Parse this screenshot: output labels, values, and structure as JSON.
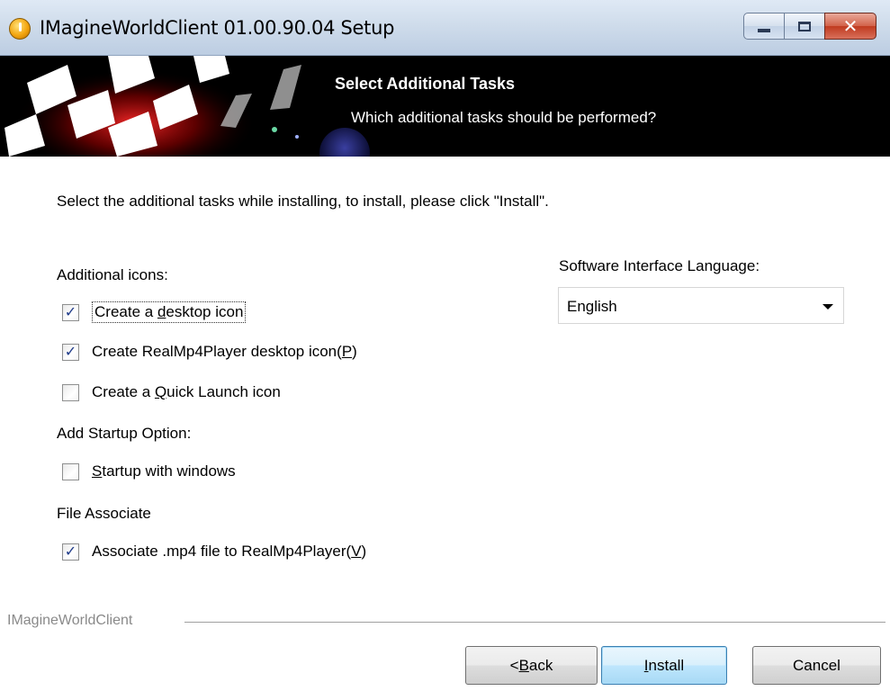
{
  "window": {
    "title": "IMagineWorldClient 01.00.90.04 Setup",
    "controls": {
      "minimize_icon": "minimize-icon",
      "maximize_icon": "maximize-icon",
      "close_icon": "close-icon"
    }
  },
  "header": {
    "title": "Select Additional Tasks",
    "subtitle": "Which additional tasks should be performed?"
  },
  "content": {
    "intro": "Select the additional tasks while installing, to install, please click \"Install\".",
    "groups": [
      {
        "label": "Additional icons:",
        "items": [
          {
            "pre": "Create a ",
            "accel": "d",
            "post": "esktop icon",
            "checked": true
          },
          {
            "pre": "Create RealMp4Player desktop icon(",
            "accel": "P",
            "post": ")",
            "checked": true
          },
          {
            "pre": "Create a ",
            "accel": "Q",
            "post": "uick Launch icon",
            "checked": false
          }
        ]
      },
      {
        "label": "Add Startup Option:",
        "items": [
          {
            "pre": "",
            "accel": "S",
            "post": "tartup with windows",
            "checked": false
          }
        ]
      },
      {
        "label": "File Associate",
        "items": [
          {
            "pre": "Associate .mp4 file to RealMp4Player(",
            "accel": "V",
            "post": ")",
            "checked": true
          }
        ]
      }
    ],
    "language": {
      "label": "Software Interface Language:",
      "selected": "English"
    }
  },
  "footer": {
    "brand": "IMagineWorldClient",
    "buttons": {
      "back_pre": "< ",
      "back_accel": "B",
      "back_post": "ack",
      "install_accel": "I",
      "install_post": "nstall",
      "cancel": "Cancel"
    }
  },
  "colors": {
    "banner_bg": "#000000",
    "checkmark": "#1f3b8a",
    "install_border": "#3c7fb1",
    "close_button": "#c03a1f"
  }
}
